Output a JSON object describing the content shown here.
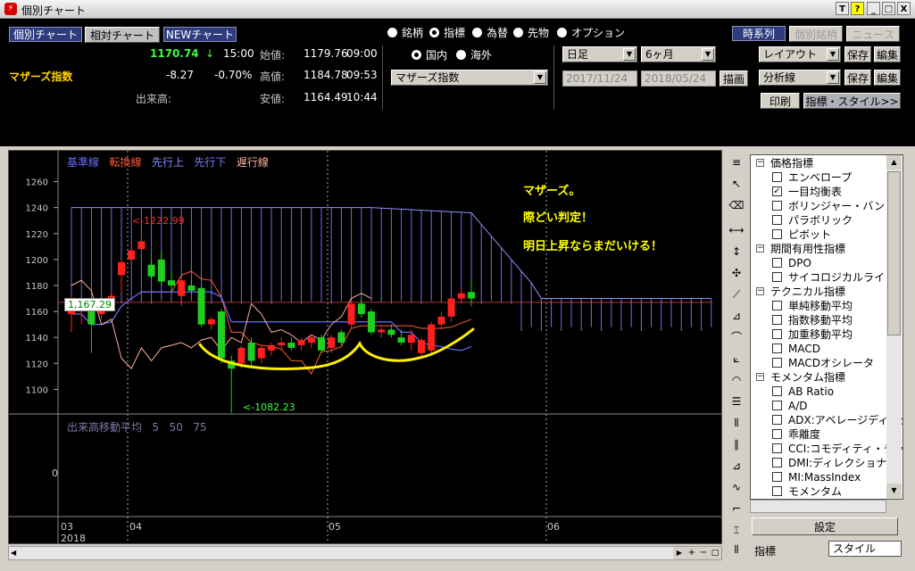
{
  "window": {
    "title": "個別チャート"
  },
  "titlebar_buttons": [
    "T",
    "?",
    "_",
    "□",
    "X"
  ],
  "mode_buttons": [
    "個別チャート",
    "相対チャート",
    "NEWチャート"
  ],
  "quote": {
    "name": "マザーズ指数",
    "price": "1170.74",
    "arrow": "↓",
    "time": "15:00",
    "change": "-8.27",
    "change_pct": "-0.70%",
    "volume_label": "出来高:",
    "open_label": "始値:",
    "open": "1179.76",
    "open_time": "09:00",
    "high_label": "高値:",
    "high": "1184.78",
    "high_time": "09:53",
    "low_label": "安値:",
    "low": "1164.49",
    "low_time": "10:44"
  },
  "asset_radios": [
    {
      "label": "銘柄",
      "selected": false
    },
    {
      "label": "指標",
      "selected": true
    },
    {
      "label": "為替",
      "selected": false
    },
    {
      "label": "先物",
      "selected": false
    },
    {
      "label": "オプション",
      "selected": false
    }
  ],
  "market_radios": [
    {
      "label": "国内",
      "selected": true
    },
    {
      "label": "海外",
      "selected": false
    }
  ],
  "index_select": "マザーズ指数",
  "period_select": "日足",
  "range_select": "6ヶ月",
  "date_from": "2017/11/24",
  "date_to": "2018/05/24",
  "draw_button": "描画",
  "view_tabs": [
    "時系列",
    "個別銘柄",
    "ニュース"
  ],
  "layout_select": "レイアウト",
  "analysis_select": "分析線",
  "save_button": "保存",
  "edit_button": "編集",
  "print_button": "印刷",
  "indicator_style_button": "指標・スタイル>>",
  "legend": [
    {
      "label": "基準線",
      "color": "#6a6aff"
    },
    {
      "label": "転換線",
      "color": "#ff5a3a"
    },
    {
      "label": "先行上",
      "color": "#8a8aff"
    },
    {
      "label": "先行下",
      "color": "#7a7aff"
    },
    {
      "label": "遅行線",
      "color": "#ffb0a0"
    }
  ],
  "annotations": {
    "line1": "マザーズ。",
    "line2": "際どい判定！",
    "line3": "明日上昇ならまだいける！",
    "high_marker": "<-1222.99",
    "low_marker": "<-1082.23",
    "price_box": "1,167.29"
  },
  "volume_pane": {
    "label": "出来高移動平均",
    "p1": "5",
    "p2": "50",
    "p3": "75",
    "zero": "0"
  },
  "x_axis": {
    "months": [
      "03",
      "04",
      "05",
      "06"
    ],
    "year": "2018"
  },
  "chart_data": {
    "type": "candlestick",
    "ylim": [
      1090,
      1270
    ],
    "yticks": [
      1100,
      1120,
      1140,
      1160,
      1180,
      1200,
      1220,
      1240,
      1260
    ],
    "current_price_line": 1167,
    "candles": [
      {
        "o": 1158,
        "h": 1172,
        "l": 1144,
        "c": 1168
      },
      {
        "o": 1160,
        "h": 1166,
        "l": 1150,
        "c": 1162
      },
      {
        "o": 1165,
        "h": 1168,
        "l": 1128,
        "c": 1150
      },
      {
        "o": 1158,
        "h": 1172,
        "l": 1154,
        "c": 1169
      },
      {
        "o": 1170,
        "h": 1176,
        "l": 1160,
        "c": 1172
      },
      {
        "o": 1188,
        "h": 1200,
        "l": 1175,
        "c": 1198
      },
      {
        "o": 1200,
        "h": 1212,
        "l": 1195,
        "c": 1207
      },
      {
        "o": 1208,
        "h": 1222,
        "l": 1204,
        "c": 1214
      },
      {
        "o": 1196,
        "h": 1200,
        "l": 1185,
        "c": 1187
      },
      {
        "o": 1200,
        "h": 1206,
        "l": 1180,
        "c": 1183
      },
      {
        "o": 1184,
        "h": 1190,
        "l": 1175,
        "c": 1180
      },
      {
        "o": 1172,
        "h": 1186,
        "l": 1164,
        "c": 1184
      },
      {
        "o": 1180,
        "h": 1184,
        "l": 1174,
        "c": 1176
      },
      {
        "o": 1178,
        "h": 1180,
        "l": 1148,
        "c": 1150
      },
      {
        "o": 1150,
        "h": 1156,
        "l": 1146,
        "c": 1154
      },
      {
        "o": 1160,
        "h": 1162,
        "l": 1120,
        "c": 1124
      },
      {
        "o": 1122,
        "h": 1126,
        "l": 1082,
        "c": 1116
      },
      {
        "o": 1120,
        "h": 1134,
        "l": 1116,
        "c": 1132
      },
      {
        "o": 1136,
        "h": 1140,
        "l": 1118,
        "c": 1122
      },
      {
        "o": 1124,
        "h": 1134,
        "l": 1120,
        "c": 1132
      },
      {
        "o": 1130,
        "h": 1136,
        "l": 1126,
        "c": 1134
      },
      {
        "o": 1134,
        "h": 1140,
        "l": 1130,
        "c": 1136
      },
      {
        "o": 1136,
        "h": 1140,
        "l": 1130,
        "c": 1132
      },
      {
        "o": 1134,
        "h": 1140,
        "l": 1130,
        "c": 1138
      },
      {
        "o": 1136,
        "h": 1142,
        "l": 1132,
        "c": 1140
      },
      {
        "o": 1140,
        "h": 1142,
        "l": 1128,
        "c": 1130
      },
      {
        "o": 1132,
        "h": 1142,
        "l": 1128,
        "c": 1140
      },
      {
        "o": 1144,
        "h": 1146,
        "l": 1134,
        "c": 1136
      },
      {
        "o": 1150,
        "h": 1168,
        "l": 1146,
        "c": 1166
      },
      {
        "o": 1166,
        "h": 1170,
        "l": 1155,
        "c": 1158
      },
      {
        "o": 1160,
        "h": 1162,
        "l": 1142,
        "c": 1144
      },
      {
        "o": 1144,
        "h": 1148,
        "l": 1140,
        "c": 1146
      },
      {
        "o": 1146,
        "h": 1150,
        "l": 1140,
        "c": 1142
      },
      {
        "o": 1140,
        "h": 1146,
        "l": 1134,
        "c": 1136
      },
      {
        "o": 1136,
        "h": 1146,
        "l": 1130,
        "c": 1142
      },
      {
        "o": 1128,
        "h": 1140,
        "l": 1124,
        "c": 1138
      },
      {
        "o": 1130,
        "h": 1152,
        "l": 1128,
        "c": 1150
      },
      {
        "o": 1150,
        "h": 1160,
        "l": 1146,
        "c": 1156
      },
      {
        "o": 1156,
        "h": 1172,
        "l": 1152,
        "c": 1170
      },
      {
        "o": 1170,
        "h": 1178,
        "l": 1166,
        "c": 1174
      },
      {
        "o": 1175,
        "h": 1184,
        "l": 1164,
        "c": 1170
      }
    ]
  },
  "indicator_tree": [
    {
      "label": "価格指標",
      "group": true
    },
    {
      "label": "エンベロープ",
      "checked": false
    },
    {
      "label": "一目均衡表",
      "checked": true
    },
    {
      "label": "ボリンジャー・バンド",
      "checked": false
    },
    {
      "label": "パラボリック",
      "checked": false
    },
    {
      "label": "ピボット",
      "checked": false
    },
    {
      "label": "期間有用性指標",
      "group": true
    },
    {
      "label": "DPO",
      "checked": false
    },
    {
      "label": "サイコロジカルライン",
      "checked": false
    },
    {
      "label": "テクニカル指標",
      "group": true
    },
    {
      "label": "単純移動平均",
      "checked": false
    },
    {
      "label": "指数移動平均",
      "checked": false
    },
    {
      "label": "加重移動平均",
      "checked": false
    },
    {
      "label": "MACD",
      "checked": false
    },
    {
      "label": "MACDオシレータ",
      "checked": false
    },
    {
      "label": "モメンタム指標",
      "group": true
    },
    {
      "label": "AB Ratio",
      "checked": false
    },
    {
      "label": "A/D",
      "checked": false
    },
    {
      "label": "ADX:アベレージディレクショナル",
      "checked": false
    },
    {
      "label": "乖離度",
      "checked": false
    },
    {
      "label": "CCI:コモディティ・チャネル",
      "checked": false
    },
    {
      "label": "DMI:ディレクショナル",
      "checked": false
    },
    {
      "label": "MI:MassIndex",
      "checked": false
    },
    {
      "label": "モメンタム",
      "checked": false
    }
  ],
  "settings_button": "設定",
  "bottom_tabs": [
    "指標",
    "スタイル"
  ]
}
